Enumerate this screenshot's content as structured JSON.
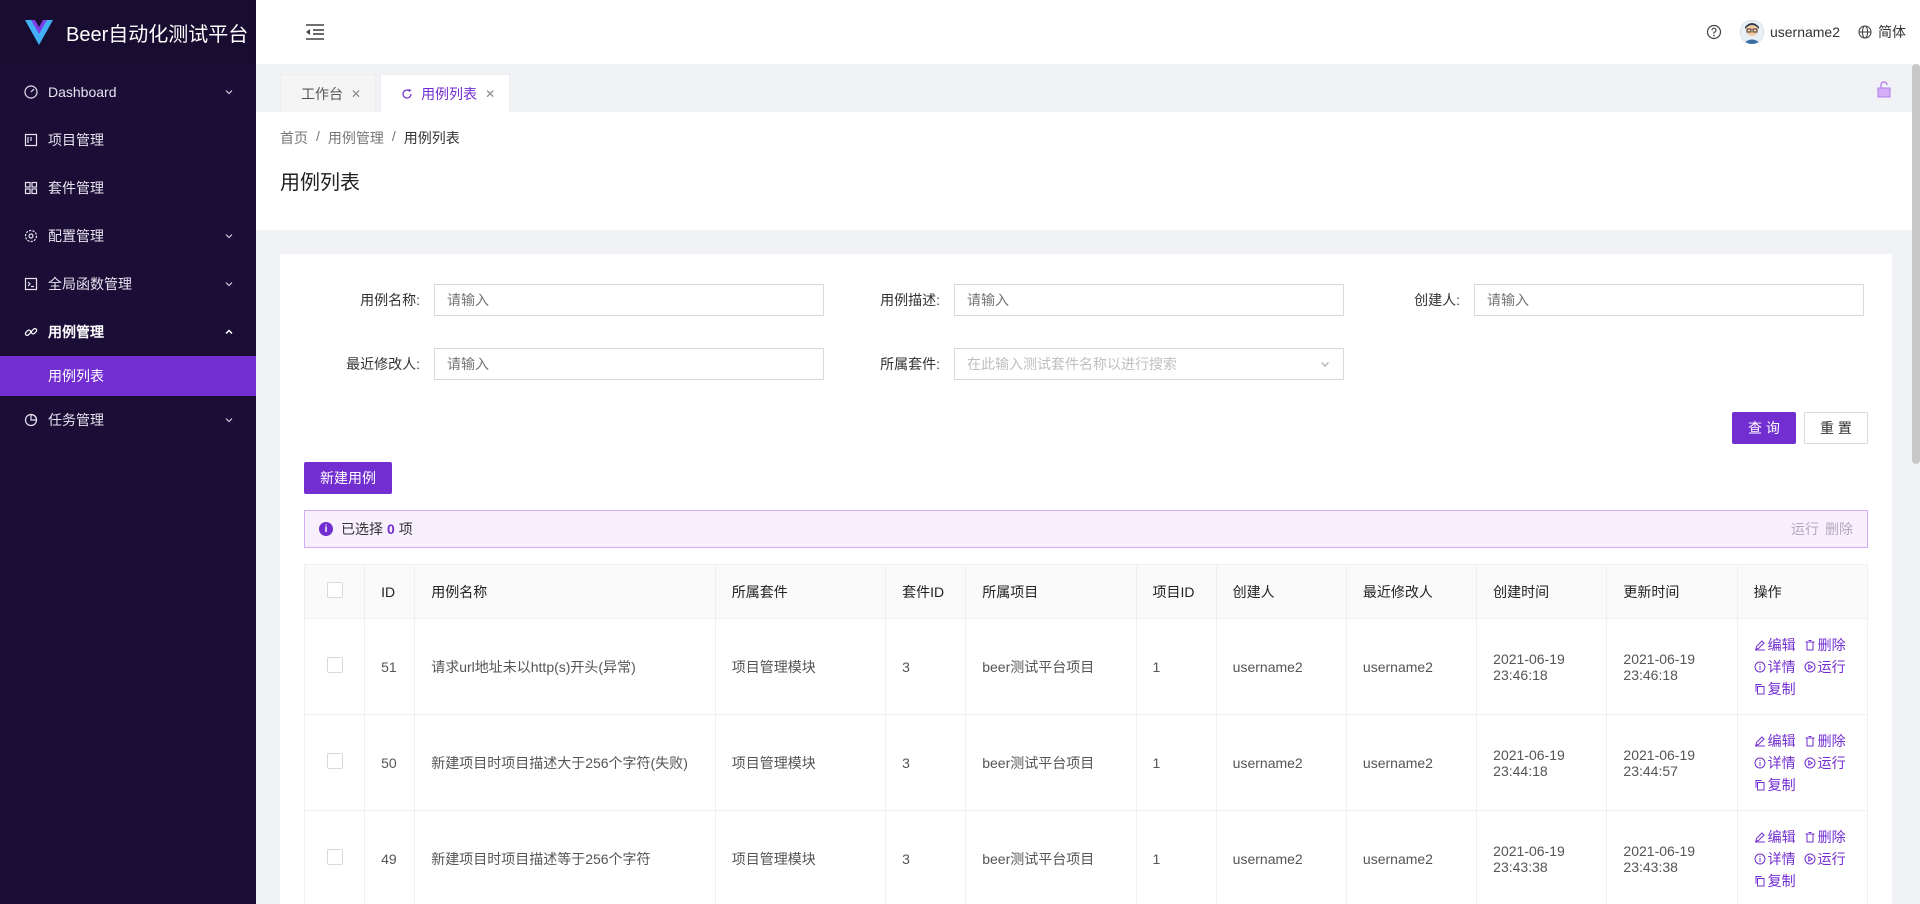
{
  "app": {
    "title": "Beer自动化测试平台"
  },
  "sidebar": {
    "items": [
      {
        "label": "Dashboard",
        "icon": "dashboard-icon",
        "has_arrow": true
      },
      {
        "label": "项目管理",
        "icon": "project-icon",
        "has_arrow": false
      },
      {
        "label": "套件管理",
        "icon": "appstore-icon",
        "has_arrow": false
      },
      {
        "label": "配置管理",
        "icon": "gear-icon",
        "has_arrow": true
      },
      {
        "label": "全局函数管理",
        "icon": "code-icon",
        "has_arrow": true
      },
      {
        "label": "用例管理",
        "icon": "link-icon",
        "has_arrow": true,
        "open": true
      },
      {
        "label": "任务管理",
        "icon": "pie-icon",
        "has_arrow": true
      }
    ],
    "subitem": {
      "label": "用例列表"
    }
  },
  "header": {
    "username": "username2",
    "language": "简体"
  },
  "tabs": [
    {
      "label": "工作台",
      "active": false
    },
    {
      "label": "用例列表",
      "active": true
    }
  ],
  "breadcrumb": {
    "home": "首页",
    "parent": "用例管理",
    "current": "用例列表",
    "sep": "/"
  },
  "page": {
    "title": "用例列表"
  },
  "form": {
    "case_name_label": "用例名称",
    "case_desc_label": "用例描述",
    "creator_label": "创建人",
    "modifier_label": "最近修改人",
    "suite_label": "所属套件",
    "input_placeholder": "请输入",
    "suite_placeholder": "在此输入测试套件名称以进行搜索",
    "colon": ":",
    "query_label": "查 询",
    "reset_label": "重 置"
  },
  "toolbar": {
    "new_case_label": "新建用例"
  },
  "alert": {
    "prefix": "已选择",
    "count": "0",
    "suffix": "项",
    "run_label": "运行",
    "delete_label": "删除"
  },
  "table": {
    "columns": [
      "ID",
      "用例名称",
      "所属套件",
      "套件ID",
      "所属项目",
      "项目ID",
      "创建人",
      "最近修改人",
      "创建时间",
      "更新时间",
      "操作"
    ],
    "rows": [
      {
        "id": "51",
        "name": "请求url地址未以http(s)开头(异常)",
        "suite": "项目管理模块",
        "suite_id": "3",
        "project": "beer测试平台项目",
        "project_id": "1",
        "creator": "username2",
        "modifier": "username2",
        "created_date": "2021-06-19",
        "created_time": "23:46:18",
        "updated_date": "2021-06-19",
        "updated_time": "23:46:18"
      },
      {
        "id": "50",
        "name": "新建项目时项目描述大于256个字符(失败)",
        "suite": "项目管理模块",
        "suite_id": "3",
        "project": "beer测试平台项目",
        "project_id": "1",
        "creator": "username2",
        "modifier": "username2",
        "created_date": "2021-06-19",
        "created_time": "23:44:18",
        "updated_date": "2021-06-19",
        "updated_time": "23:44:57"
      },
      {
        "id": "49",
        "name": "新建项目时项目描述等于256个字符",
        "suite": "项目管理模块",
        "suite_id": "3",
        "project": "beer测试平台项目",
        "project_id": "1",
        "creator": "username2",
        "modifier": "username2",
        "created_date": "2021-06-19",
        "created_time": "23:43:38",
        "updated_date": "2021-06-19",
        "updated_time": "23:43:38"
      }
    ],
    "actions": {
      "edit": "编辑",
      "delete": "删除",
      "detail": "详情",
      "run": "运行",
      "copy": "复制"
    }
  },
  "colors": {
    "primary": "#722ed1",
    "sidebar_bg": "#1b0e36"
  }
}
